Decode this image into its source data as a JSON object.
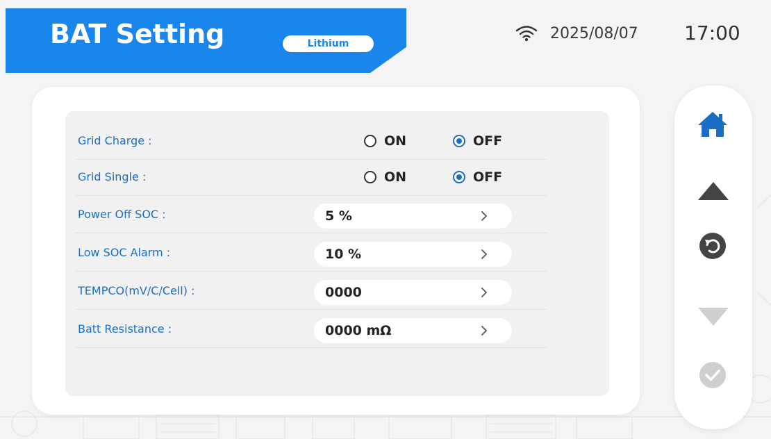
{
  "header": {
    "title": "BAT Setting",
    "battery_type": "Lithium",
    "date": "2025/08/07",
    "time": "17:00",
    "wifi_icon": "wifi-icon"
  },
  "settings": {
    "grid_charge": {
      "label": "Grid Charge :",
      "on_label": "ON",
      "off_label": "OFF",
      "selected": "OFF"
    },
    "grid_single": {
      "label": "Grid Single :",
      "on_label": "ON",
      "off_label": "OFF",
      "selected": "OFF"
    },
    "power_off_soc": {
      "label": "Power Off  SOC :",
      "value": "5 %"
    },
    "low_soc_alarm": {
      "label": "Low SOC Alarm :",
      "value": "10 %"
    },
    "tempco": {
      "label": "TEMPCO(mV/C/Cell) :",
      "value": "0000"
    },
    "batt_resistance": {
      "label": "Batt Resistance :",
      "value": "0000 mΩ"
    }
  },
  "side_nav": {
    "icons": [
      "home-icon",
      "arrow-up-icon",
      "back-icon",
      "arrow-down-icon",
      "confirm-icon"
    ]
  },
  "colors": {
    "accent": "#1a86ec",
    "label_blue": "#1a6fc4",
    "nav_dark": "#444444",
    "nav_disabled": "#cfcfcf"
  }
}
